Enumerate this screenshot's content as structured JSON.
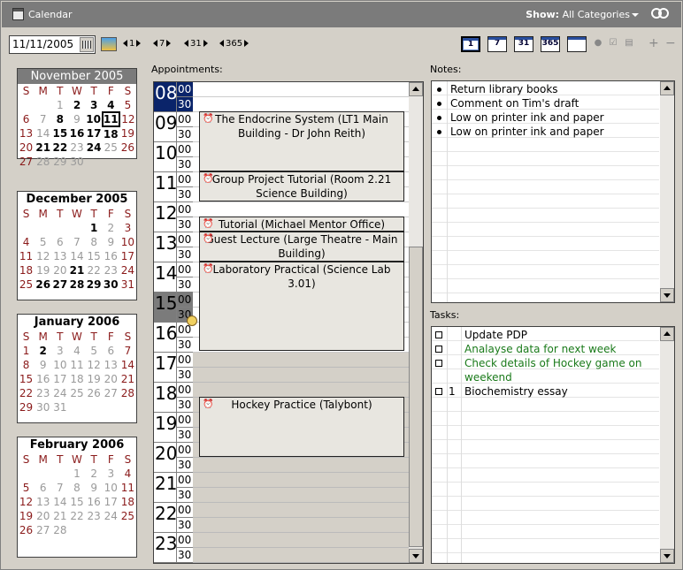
{
  "window": {
    "title": "Calendar",
    "show_label": "Show:",
    "show_value": "All Categories"
  },
  "toolbar": {
    "date_value": "11/11/2005",
    "jumps": [
      "1",
      "7",
      "31",
      "365"
    ],
    "view_buttons": [
      "1",
      "7",
      "31",
      "365"
    ]
  },
  "months": [
    {
      "title": "November 2005",
      "current": true,
      "weeks": [
        [
          "",
          "",
          "1",
          "2",
          "3",
          "4",
          "5"
        ],
        [
          "6",
          "7",
          "8",
          "9",
          "10",
          "11",
          "12"
        ],
        [
          "13",
          "14",
          "15",
          "16",
          "17",
          "18",
          "19"
        ],
        [
          "20",
          "21",
          "22",
          "23",
          "24",
          "25",
          "26"
        ],
        [
          "27",
          "28",
          "29",
          "30",
          "",
          "",
          " "
        ]
      ]
    },
    {
      "title": "December 2005",
      "weeks": [
        [
          "",
          "",
          "",
          "",
          "1",
          "2",
          "3"
        ],
        [
          "4",
          "5",
          "6",
          "7",
          "8",
          "9",
          "10"
        ],
        [
          "11",
          "12",
          "13",
          "14",
          "15",
          "16",
          "17"
        ],
        [
          "18",
          "19",
          "20",
          "21",
          "22",
          "23",
          "24"
        ],
        [
          "25",
          "26",
          "27",
          "28",
          "29",
          "30",
          "31"
        ]
      ]
    },
    {
      "title": "January 2006",
      "weeks": [
        [
          "1",
          "2",
          "3",
          "4",
          "5",
          "6",
          "7"
        ],
        [
          "8",
          "9",
          "10",
          "11",
          "12",
          "13",
          "14"
        ],
        [
          "15",
          "16",
          "17",
          "18",
          "19",
          "20",
          "21"
        ],
        [
          "22",
          "23",
          "24",
          "25",
          "26",
          "27",
          "28"
        ],
        [
          "29",
          "30",
          "31",
          "",
          "",
          "",
          ""
        ]
      ]
    },
    {
      "title": "February 2006",
      "weeks": [
        [
          "",
          "",
          "",
          "1",
          "2",
          "3",
          "4"
        ],
        [
          "5",
          "6",
          "7",
          "8",
          "9",
          "10",
          "11"
        ],
        [
          "12",
          "13",
          "14",
          "15",
          "16",
          "17",
          "18"
        ],
        [
          "19",
          "20",
          "21",
          "22",
          "23",
          "24",
          "25"
        ],
        [
          "26",
          "27",
          "28",
          "",
          "",
          "",
          ""
        ]
      ]
    }
  ],
  "weekday_headers": [
    "S",
    "M",
    "T",
    "W",
    "T",
    "F",
    "S"
  ],
  "appointments": {
    "label": "Appointments:",
    "hours": [
      "08",
      "09",
      "10",
      "11",
      "12",
      "13",
      "14",
      "15",
      "16",
      "17",
      "18",
      "19",
      "20",
      "21",
      "22",
      "23"
    ],
    "minute_labels": [
      "00",
      "30"
    ],
    "events": [
      {
        "title": "The Endocrine System (LT1 Main Building - Dr John Reith)"
      },
      {
        "title": "Group Project Tutorial (Room 2.21 Science Building)"
      },
      {
        "title": "Tutorial (Michael Mentor Office)"
      },
      {
        "title": "Guest Lecture (Large Theatre - Main Building)"
      },
      {
        "title": "Laboratory Practical (Science Lab 3.01)"
      },
      {
        "title": "Hockey Practice (Talybont)"
      }
    ]
  },
  "notes": {
    "label": "Notes:",
    "items": [
      "Return library books",
      "Comment on Tim's draft",
      "Low on printer ink and paper",
      "Low on printer ink and paper"
    ]
  },
  "tasks": {
    "label": "Tasks:",
    "items": [
      {
        "text": "Update PDP",
        "priority": "",
        "color": "#000000"
      },
      {
        "text": "Analayse data for next week",
        "priority": "",
        "color": "#1a7a1a"
      },
      {
        "text": "Check details of Hockey game on weekend",
        "priority": "",
        "color": "#1a7a1a"
      },
      {
        "text": "Biochemistry essay",
        "priority": "1",
        "color": "#000000"
      }
    ]
  }
}
